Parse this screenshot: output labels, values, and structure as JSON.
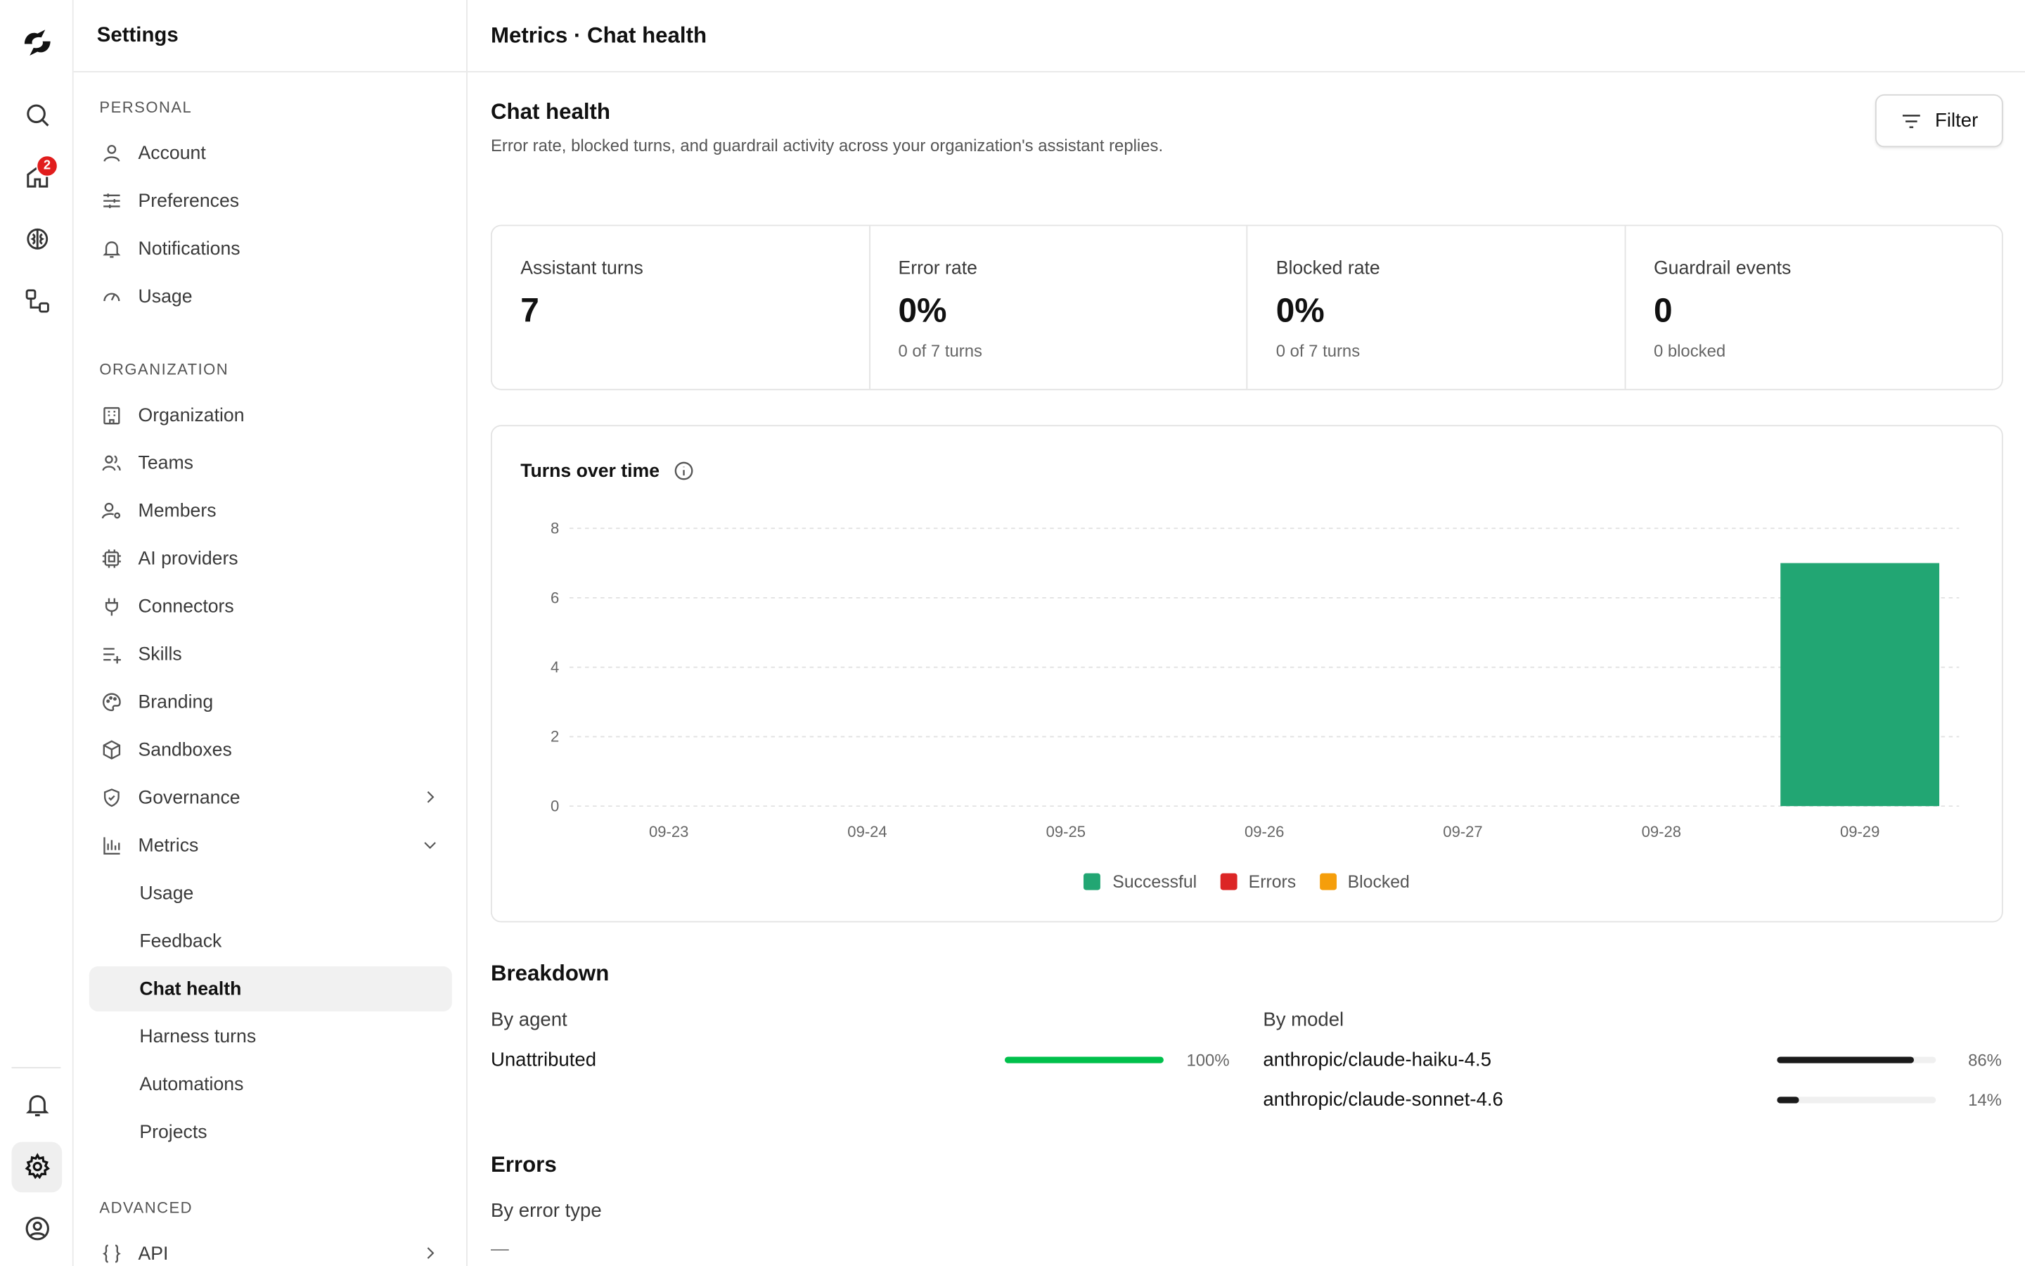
{
  "app": {
    "badge_count": "2"
  },
  "sidebar": {
    "title": "Settings",
    "sections": {
      "personal": "PERSONAL",
      "organization": "ORGANIZATION",
      "advanced": "ADVANCED"
    },
    "personal": [
      {
        "label": "Account",
        "icon": "user-icon"
      },
      {
        "label": "Preferences",
        "icon": "sliders-icon"
      },
      {
        "label": "Notifications",
        "icon": "bell-icon"
      },
      {
        "label": "Usage",
        "icon": "gauge-icon"
      }
    ],
    "organization": [
      {
        "label": "Organization",
        "icon": "building-icon"
      },
      {
        "label": "Teams",
        "icon": "users-icon"
      },
      {
        "label": "Members",
        "icon": "user-cog-icon"
      },
      {
        "label": "AI providers",
        "icon": "cpu-icon"
      },
      {
        "label": "Connectors",
        "icon": "plug-icon"
      },
      {
        "label": "Skills",
        "icon": "list-plus-icon"
      },
      {
        "label": "Branding",
        "icon": "palette-icon"
      },
      {
        "label": "Sandboxes",
        "icon": "box-icon"
      },
      {
        "label": "Governance",
        "icon": "shield-icon"
      },
      {
        "label": "Metrics",
        "icon": "bar-chart-icon"
      }
    ],
    "metrics_sub": [
      "Usage",
      "Feedback",
      "Chat health",
      "Harness turns",
      "Automations",
      "Projects"
    ],
    "active": "Chat health",
    "advanced": [
      {
        "label": "API",
        "icon": "braces-icon"
      }
    ]
  },
  "header": {
    "breadcrumb": "Metrics · Chat health"
  },
  "page": {
    "title": "Chat health",
    "subtitle": "Error rate, blocked turns, and guardrail activity across your organization's assistant replies.",
    "filter_label": "Filter"
  },
  "stats": [
    {
      "label": "Assistant turns",
      "value": "7",
      "sub": ""
    },
    {
      "label": "Error rate",
      "value": "0%",
      "sub": "0 of 7 turns"
    },
    {
      "label": "Blocked rate",
      "value": "0%",
      "sub": "0 of 7 turns"
    },
    {
      "label": "Guardrail events",
      "value": "0",
      "sub": "0 blocked"
    }
  ],
  "chart_title": "Turns over time",
  "chart_data": {
    "type": "bar",
    "categories": [
      "09-23",
      "09-24",
      "09-25",
      "09-26",
      "09-27",
      "09-28",
      "09-29"
    ],
    "series": [
      {
        "name": "Successful",
        "color": "#22a673",
        "values": [
          0,
          0,
          0,
          0,
          0,
          0,
          7
        ]
      },
      {
        "name": "Errors",
        "color": "#dc2626",
        "values": [
          0,
          0,
          0,
          0,
          0,
          0,
          0
        ]
      },
      {
        "name": "Blocked",
        "color": "#f59e0b",
        "values": [
          0,
          0,
          0,
          0,
          0,
          0,
          0
        ]
      }
    ],
    "stacked": true,
    "ylim": [
      0,
      8
    ],
    "yticks": [
      "0",
      "2",
      "4",
      "6",
      "8"
    ],
    "grid": true,
    "legend": "bottom-center"
  },
  "breakdown": {
    "title": "Breakdown",
    "by_agent": {
      "title": "By agent",
      "rows": [
        {
          "label": "Unattributed",
          "pct": "100%",
          "fraction": 1.0,
          "color": "#00c04b"
        }
      ]
    },
    "by_model": {
      "title": "By model",
      "rows": [
        {
          "label": "anthropic/claude-haiku-4.5",
          "pct": "86%",
          "fraction": 0.86,
          "color": "#1a1a1a"
        },
        {
          "label": "anthropic/claude-sonnet-4.6",
          "pct": "14%",
          "fraction": 0.14,
          "color": "#1a1a1a"
        }
      ]
    }
  },
  "errors": {
    "title": "Errors",
    "by_type": "By error type",
    "empty": "—"
  }
}
